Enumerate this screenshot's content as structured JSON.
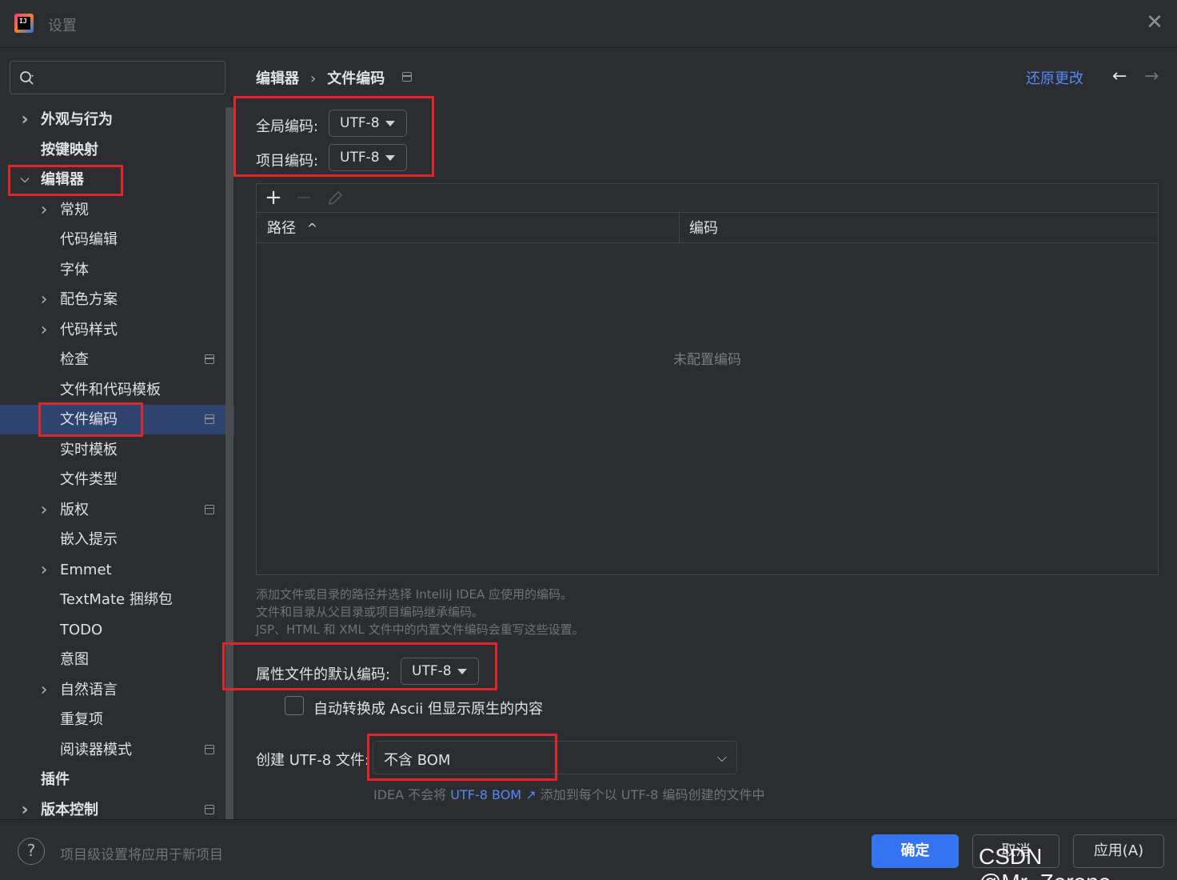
{
  "window": {
    "title": "设置",
    "close_symbol": "✕"
  },
  "sidebar": {
    "search_placeholder": "",
    "items": [
      {
        "label": "外观与行为",
        "bold": true,
        "chevron": "right"
      },
      {
        "label": "按键映射",
        "bold": true
      },
      {
        "label": "编辑器",
        "bold": true,
        "chevron": "down"
      },
      {
        "label": "常规",
        "chevron": "right"
      },
      {
        "label": "代码编辑"
      },
      {
        "label": "字体"
      },
      {
        "label": "配色方案",
        "chevron": "right"
      },
      {
        "label": "代码样式",
        "chevron": "right"
      },
      {
        "label": "检查",
        "project_icon": true
      },
      {
        "label": "文件和代码模板"
      },
      {
        "label": "文件编码",
        "selected": true,
        "project_icon": true
      },
      {
        "label": "实时模板"
      },
      {
        "label": "文件类型"
      },
      {
        "label": "版权",
        "chevron": "right",
        "project_icon": true
      },
      {
        "label": "嵌入提示"
      },
      {
        "label": "Emmet",
        "chevron": "right"
      },
      {
        "label": "TextMate 捆绑包"
      },
      {
        "label": "TODO"
      },
      {
        "label": "意图"
      },
      {
        "label": "自然语言",
        "chevron": "right"
      },
      {
        "label": "重复项"
      },
      {
        "label": "阅读器模式",
        "project_icon": true
      },
      {
        "label": "插件",
        "bold": true
      },
      {
        "label": "版本控制",
        "bold": true,
        "chevron": "right",
        "project_icon": true
      }
    ]
  },
  "header": {
    "breadcrumb_parent": "编辑器",
    "breadcrumb_sep": "›",
    "breadcrumb_current": "文件编码",
    "restore_label": "还原更改",
    "back_symbol": "←",
    "forward_symbol": "→"
  },
  "encoding": {
    "global_label": "全局编码:",
    "global_value": "UTF-8",
    "project_label": "项目编码:",
    "project_value": "UTF-8"
  },
  "table": {
    "add_symbol": "+",
    "remove_symbol": "—",
    "edit_icon": "pencil-icon",
    "col_path": "路径",
    "sort_symbol": "^",
    "col_encoding": "编码",
    "empty_text": "未配置编码"
  },
  "help_lines": [
    "添加文件或目录的路径并选择 IntelliJ IDEA 应使用的编码。",
    "文件和目录从父目录或项目编码继承编码。",
    "JSP、HTML 和 XML 文件中的内置文件编码会重写这些设置。"
  ],
  "properties": {
    "label": "属性文件的默认编码:",
    "value": "UTF-8",
    "checkbox_label": "自动转换成 Ascii 但显示原生的内容",
    "checkbox_checked": false
  },
  "bom": {
    "label": "创建 UTF-8 文件:",
    "value": "不含 BOM",
    "help_prefix": "IDEA 不会将",
    "help_link": "UTF-8 BOM ↗",
    "help_suffix": "添加到每个以 UTF-8 编码创建的文件中"
  },
  "footer": {
    "help_symbol": "?",
    "note": "项目级设置将应用于新项目",
    "ok_label": "确定",
    "cancel_label": "取消",
    "apply_label": "应用(A)"
  },
  "watermark": "CSDN @Mr_Zerone",
  "colors": {
    "accent": "#3574f0",
    "link": "#548af7",
    "highlight_box": "#e0252b",
    "selection": "#2e436e"
  }
}
